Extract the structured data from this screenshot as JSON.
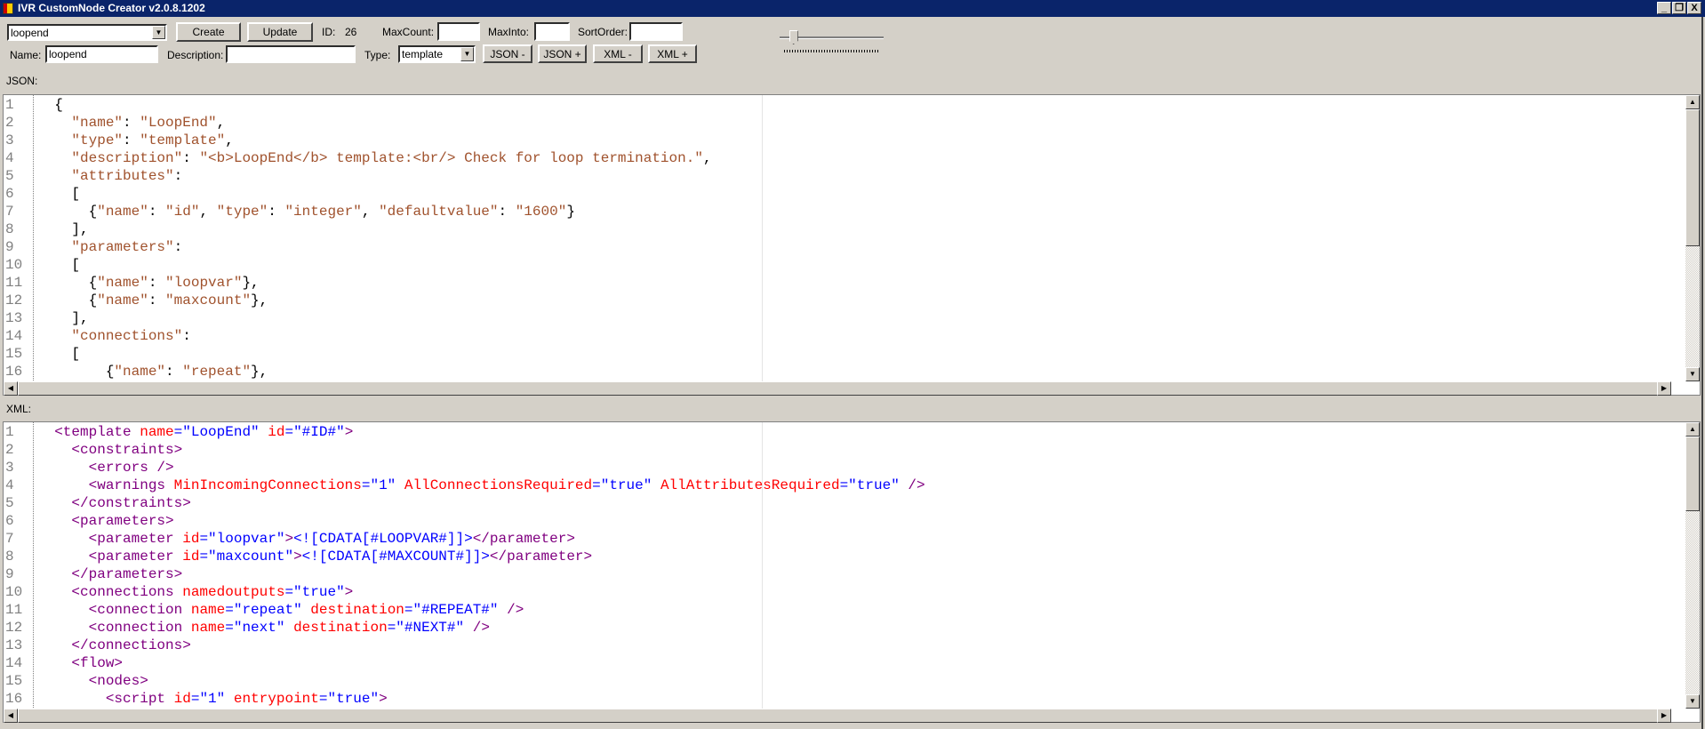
{
  "window": {
    "title": "IVR CustomNode Creator v2.0.8.1202",
    "minimize": "_",
    "restore": "❐",
    "close": "X"
  },
  "toolbar": {
    "node_select": "loopend",
    "create_label": "Create",
    "update_label": "Update",
    "id_label": "ID:",
    "id_value": "26",
    "maxcount_label": "MaxCount:",
    "maxcount_value": "",
    "maxinto_label": "MaxInto:",
    "maxinto_value": "",
    "sortorder_label": "SortOrder:",
    "sortorder_value": "",
    "name_label": "Name:",
    "name_value": "loopend",
    "description_label": "Description:",
    "description_value": "",
    "type_label": "Type:",
    "type_value": "template",
    "json_minus": "JSON -",
    "json_plus": "JSON +",
    "xml_minus": "XML -",
    "xml_plus": "XML +",
    "slider_value_fraction": 0.1
  },
  "json_label": "JSON:",
  "xml_label": "XML:",
  "colors": {
    "json_string": "#a0522d",
    "xml_tag": "#800080",
    "xml_attr": "#ff0000",
    "xml_value": "#0000ff",
    "title_bar": "#0a246a"
  },
  "json_editor": {
    "lines": [
      [
        [
          "p",
          "  {"
        ]
      ],
      [
        [
          "s",
          "    \"name\""
        ],
        [
          "p",
          ": "
        ],
        [
          "s",
          "\"LoopEnd\""
        ],
        [
          "p",
          ","
        ]
      ],
      [
        [
          "s",
          "    \"type\""
        ],
        [
          "p",
          ": "
        ],
        [
          "s",
          "\"template\""
        ],
        [
          "p",
          ","
        ]
      ],
      [
        [
          "s",
          "    \"description\""
        ],
        [
          "p",
          ": "
        ],
        [
          "s",
          "\"<b>LoopEnd</b> template:<br/> Check for loop termination.\""
        ],
        [
          "p",
          ","
        ]
      ],
      [
        [
          "s",
          "    \"attributes\""
        ],
        [
          "p",
          ":"
        ]
      ],
      [
        [
          "p",
          "    ["
        ]
      ],
      [
        [
          "p",
          "      {"
        ],
        [
          "s",
          "\"name\""
        ],
        [
          "p",
          ": "
        ],
        [
          "s",
          "\"id\""
        ],
        [
          "p",
          ", "
        ],
        [
          "s",
          "\"type\""
        ],
        [
          "p",
          ": "
        ],
        [
          "s",
          "\"integer\""
        ],
        [
          "p",
          ", "
        ],
        [
          "s",
          "\"defaultvalue\""
        ],
        [
          "p",
          ": "
        ],
        [
          "s",
          "\"1600\""
        ],
        [
          "p",
          "}"
        ]
      ],
      [
        [
          "p",
          "    ],"
        ]
      ],
      [
        [
          "s",
          "    \"parameters\""
        ],
        [
          "p",
          ":"
        ]
      ],
      [
        [
          "p",
          "    ["
        ]
      ],
      [
        [
          "p",
          "      {"
        ],
        [
          "s",
          "\"name\""
        ],
        [
          "p",
          ": "
        ],
        [
          "s",
          "\"loopvar\""
        ],
        [
          "p",
          "},"
        ]
      ],
      [
        [
          "p",
          "      {"
        ],
        [
          "s",
          "\"name\""
        ],
        [
          "p",
          ": "
        ],
        [
          "s",
          "\"maxcount\""
        ],
        [
          "p",
          "},"
        ]
      ],
      [
        [
          "p",
          "    ],"
        ]
      ],
      [
        [
          "s",
          "    \"connections\""
        ],
        [
          "p",
          ":"
        ]
      ],
      [
        [
          "p",
          "    ["
        ]
      ],
      [
        [
          "p",
          "        {"
        ],
        [
          "s",
          "\"name\""
        ],
        [
          "p",
          ": "
        ],
        [
          "s",
          "\"repeat\""
        ],
        [
          "p",
          "},"
        ]
      ]
    ]
  },
  "xml_editor": {
    "lines": [
      [
        [
          "t",
          "  <template"
        ],
        [
          "a",
          " name"
        ],
        [
          "v",
          "=\"LoopEnd\""
        ],
        [
          "a",
          " id"
        ],
        [
          "v",
          "=\"#ID#\""
        ],
        [
          "t",
          ">"
        ]
      ],
      [
        [
          "t",
          "    <constraints>"
        ]
      ],
      [
        [
          "t",
          "      <errors />"
        ]
      ],
      [
        [
          "t",
          "      <warnings"
        ],
        [
          "a",
          " MinIncomingConnections"
        ],
        [
          "v",
          "=\"1\""
        ],
        [
          "a",
          " AllConnectionsRequired"
        ],
        [
          "v",
          "=\"true\""
        ],
        [
          "a",
          " AllAttributesRequired"
        ],
        [
          "v",
          "=\"true\""
        ],
        [
          "t",
          " />"
        ]
      ],
      [
        [
          "t",
          "    </constraints>"
        ]
      ],
      [
        [
          "t",
          "    <parameters>"
        ]
      ],
      [
        [
          "t",
          "      <parameter"
        ],
        [
          "a",
          " id"
        ],
        [
          "v",
          "=\"loopvar\""
        ],
        [
          "t",
          ">"
        ],
        [
          "v",
          "<![CDATA[#LOOPVAR#]]>"
        ],
        [
          "t",
          "</parameter>"
        ]
      ],
      [
        [
          "t",
          "      <parameter"
        ],
        [
          "a",
          " id"
        ],
        [
          "v",
          "=\"maxcount\""
        ],
        [
          "t",
          ">"
        ],
        [
          "v",
          "<![CDATA[#MAXCOUNT#]]>"
        ],
        [
          "t",
          "</parameter>"
        ]
      ],
      [
        [
          "t",
          "    </parameters>"
        ]
      ],
      [
        [
          "t",
          "    <connections"
        ],
        [
          "a",
          " namedoutputs"
        ],
        [
          "v",
          "=\"true\""
        ],
        [
          "t",
          ">"
        ]
      ],
      [
        [
          "t",
          "      <connection"
        ],
        [
          "a",
          " name"
        ],
        [
          "v",
          "=\"repeat\""
        ],
        [
          "a",
          " destination"
        ],
        [
          "v",
          "=\"#REPEAT#\""
        ],
        [
          "t",
          " />"
        ]
      ],
      [
        [
          "t",
          "      <connection"
        ],
        [
          "a",
          " name"
        ],
        [
          "v",
          "=\"next\""
        ],
        [
          "a",
          " destination"
        ],
        [
          "v",
          "=\"#NEXT#\""
        ],
        [
          "t",
          " />"
        ]
      ],
      [
        [
          "t",
          "    </connections>"
        ]
      ],
      [
        [
          "t",
          "    <flow>"
        ]
      ],
      [
        [
          "t",
          "      <nodes>"
        ]
      ],
      [
        [
          "t",
          "        <script"
        ],
        [
          "a",
          " id"
        ],
        [
          "v",
          "=\"1\""
        ],
        [
          "a",
          " entrypoint"
        ],
        [
          "v",
          "=\"true\""
        ],
        [
          "t",
          ">"
        ]
      ]
    ]
  }
}
